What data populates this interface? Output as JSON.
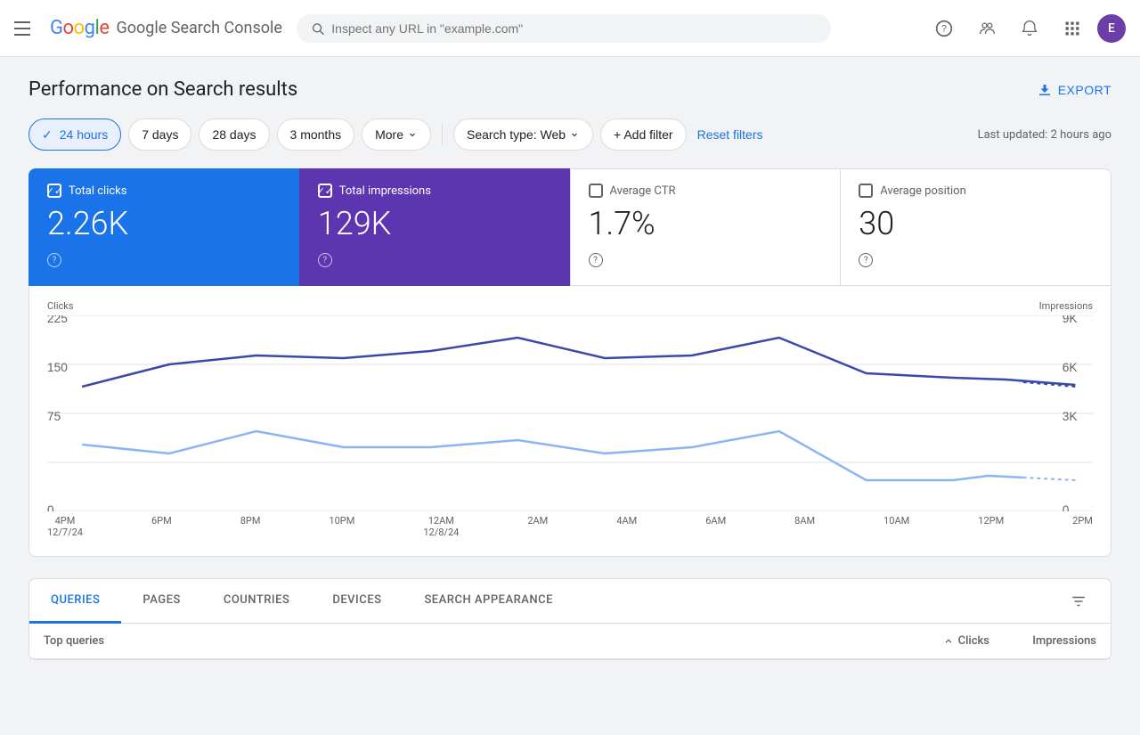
{
  "app": {
    "title": "Google Search Console",
    "logo": {
      "google": "Google",
      "product": "Search Console"
    },
    "search_placeholder": "Inspect any URL in \"example.com\"",
    "avatar_letter": "E"
  },
  "page": {
    "title": "Performance on Search results",
    "export_label": "EXPORT",
    "last_updated": "Last updated: 2 hours ago"
  },
  "filters": {
    "time_options": [
      {
        "label": "24 hours",
        "active": true
      },
      {
        "label": "7 days",
        "active": false
      },
      {
        "label": "28 days",
        "active": false
      },
      {
        "label": "3 months",
        "active": false
      },
      {
        "label": "More",
        "active": false
      }
    ],
    "search_type_label": "Search type: Web",
    "add_filter_label": "+ Add filter",
    "reset_label": "Reset filters"
  },
  "metrics": [
    {
      "id": "total-clicks",
      "label": "Total clicks",
      "value": "2.26K",
      "active": true,
      "style": "blue"
    },
    {
      "id": "total-impressions",
      "label": "Total impressions",
      "value": "129K",
      "active": true,
      "style": "purple"
    },
    {
      "id": "average-ctr",
      "label": "Average CTR",
      "value": "1.7%",
      "active": false,
      "style": "default"
    },
    {
      "id": "average-position",
      "label": "Average position",
      "value": "30",
      "active": false,
      "style": "default"
    }
  ],
  "chart": {
    "y_left_label": "Clicks",
    "y_right_label": "Impressions",
    "y_left_values": [
      "225",
      "150",
      "75",
      "0"
    ],
    "y_right_values": [
      "9K",
      "6K",
      "3K",
      "0"
    ],
    "x_labels": [
      {
        "line1": "4PM",
        "line2": "12/7/24"
      },
      {
        "line1": "6PM",
        "line2": ""
      },
      {
        "line1": "8PM",
        "line2": ""
      },
      {
        "line1": "10PM",
        "line2": ""
      },
      {
        "line1": "12AM",
        "line2": "12/8/24"
      },
      {
        "line1": "2AM",
        "line2": ""
      },
      {
        "line1": "4AM",
        "line2": ""
      },
      {
        "line1": "6AM",
        "line2": ""
      },
      {
        "line1": "8AM",
        "line2": ""
      },
      {
        "line1": "10AM",
        "line2": ""
      },
      {
        "line1": "12PM",
        "line2": ""
      },
      {
        "line1": "2PM",
        "line2": ""
      }
    ]
  },
  "tabs": [
    {
      "label": "QUERIES",
      "active": true
    },
    {
      "label": "PAGES",
      "active": false
    },
    {
      "label": "COUNTRIES",
      "active": false
    },
    {
      "label": "DEVICES",
      "active": false
    },
    {
      "label": "SEARCH APPEARANCE",
      "active": false
    }
  ],
  "table": {
    "col_query": "Top queries",
    "col_clicks": "Clicks",
    "col_impressions": "Impressions"
  }
}
